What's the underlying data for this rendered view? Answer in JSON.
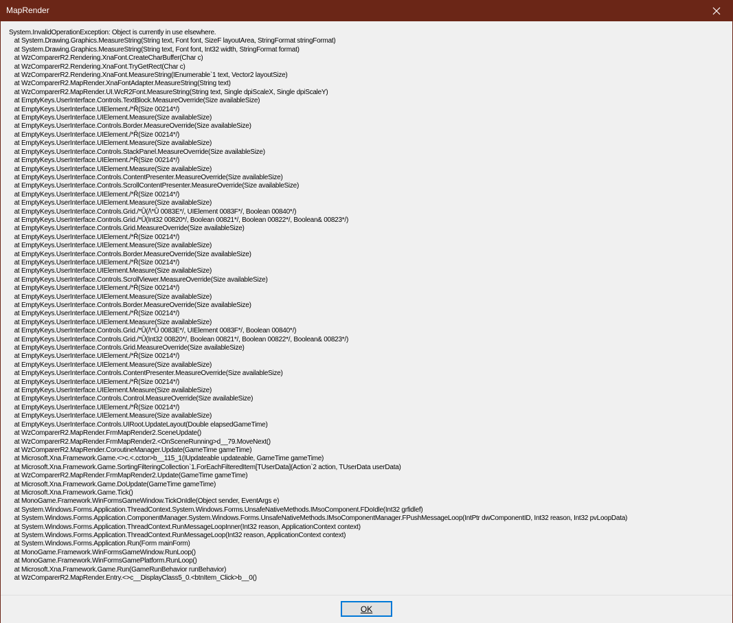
{
  "window": {
    "title": "MapRender",
    "close_icon": "close-icon"
  },
  "message": {
    "lines": [
      "System.InvalidOperationException: Object is currently in use elsewhere.",
      "   at System.Drawing.Graphics.MeasureString(String text, Font font, SizeF layoutArea, StringFormat stringFormat)",
      "   at System.Drawing.Graphics.MeasureString(String text, Font font, Int32 width, StringFormat format)",
      "   at WzComparerR2.Rendering.XnaFont.CreateCharBuffer(Char c)",
      "   at WzComparerR2.Rendering.XnaFont.TryGetRect(Char c)",
      "   at WzComparerR2.Rendering.XnaFont.MeasureString(IEnumerable`1 text, Vector2 layoutSize)",
      "   at WzComparerR2.MapRender.XnaFontAdapter.MeasureString(String text)",
      "   at WzComparerR2.MapRender.UI.WcR2Font.MeasureString(String text, Single dpiScaleX, Single dpiScaleY)",
      "   at EmptyKeys.UserInterface.Controls.TextBlock.MeasureOverride(Size availableSize)",
      "   at EmptyKeys.UserInterface.UIElement./*Ȓ(Size 00214*/)",
      "   at EmptyKeys.UserInterface.UIElement.Measure(Size availableSize)",
      "   at EmptyKeys.UserInterface.Controls.Border.MeasureOverride(Size availableSize)",
      "   at EmptyKeys.UserInterface.UIElement./*Ȓ(Size 00214*/)",
      "   at EmptyKeys.UserInterface.UIElement.Measure(Size availableSize)",
      "   at EmptyKeys.UserInterface.Controls.StackPanel.MeasureOverride(Size availableSize)",
      "   at EmptyKeys.UserInterface.UIElement./*Ȓ(Size 00214*/)",
      "   at EmptyKeys.UserInterface.UIElement.Measure(Size availableSize)",
      "   at EmptyKeys.UserInterface.Controls.ContentPresenter.MeasureOverride(Size availableSize)",
      "   at EmptyKeys.UserInterface.Controls.ScrollContentPresenter.MeasureOverride(Size availableSize)",
      "   at EmptyKeys.UserInterface.UIElement./*Ȓ(Size 00214*/)",
      "   at EmptyKeys.UserInterface.UIElement.Measure(Size availableSize)",
      "   at EmptyKeys.UserInterface.Controls.Grid./*Ǜ(/\\*Ǜ 0083E*/, UIElement 0083F*/, Boolean 00840*/)",
      "   at EmptyKeys.UserInterface.Controls.Grid./*Ǜ(Int32 00820*/, Boolean 00821*/, Boolean 00822*/, Boolean& 00823*/)",
      "   at EmptyKeys.UserInterface.Controls.Grid.MeasureOverride(Size availableSize)",
      "   at EmptyKeys.UserInterface.UIElement./*Ȓ(Size 00214*/)",
      "   at EmptyKeys.UserInterface.UIElement.Measure(Size availableSize)",
      "   at EmptyKeys.UserInterface.Controls.Border.MeasureOverride(Size availableSize)",
      "   at EmptyKeys.UserInterface.UIElement./*Ȓ(Size 00214*/)",
      "   at EmptyKeys.UserInterface.UIElement.Measure(Size availableSize)",
      "   at EmptyKeys.UserInterface.Controls.ScrollViewer.MeasureOverride(Size availableSize)",
      "   at EmptyKeys.UserInterface.UIElement./*Ȓ(Size 00214*/)",
      "   at EmptyKeys.UserInterface.UIElement.Measure(Size availableSize)",
      "   at EmptyKeys.UserInterface.Controls.Border.MeasureOverride(Size availableSize)",
      "   at EmptyKeys.UserInterface.UIElement./*Ȓ(Size 00214*/)",
      "   at EmptyKeys.UserInterface.UIElement.Measure(Size availableSize)",
      "   at EmptyKeys.UserInterface.Controls.Grid./*Ǜ(/\\*Ǜ 0083E*/, UIElement 0083F*/, Boolean 00840*/)",
      "   at EmptyKeys.UserInterface.Controls.Grid./*Ǜ(Int32 00820*/, Boolean 00821*/, Boolean 00822*/, Boolean& 00823*/)",
      "   at EmptyKeys.UserInterface.Controls.Grid.MeasureOverride(Size availableSize)",
      "   at EmptyKeys.UserInterface.UIElement./*Ȓ(Size 00214*/)",
      "   at EmptyKeys.UserInterface.UIElement.Measure(Size availableSize)",
      "   at EmptyKeys.UserInterface.Controls.ContentPresenter.MeasureOverride(Size availableSize)",
      "   at EmptyKeys.UserInterface.UIElement./*Ȓ(Size 00214*/)",
      "   at EmptyKeys.UserInterface.UIElement.Measure(Size availableSize)",
      "   at EmptyKeys.UserInterface.Controls.Control.MeasureOverride(Size availableSize)",
      "   at EmptyKeys.UserInterface.UIElement./*Ȓ(Size 00214*/)",
      "   at EmptyKeys.UserInterface.UIElement.Measure(Size availableSize)",
      "   at EmptyKeys.UserInterface.Controls.UIRoot.UpdateLayout(Double elapsedGameTime)",
      "   at WzComparerR2.MapRender.FrmMapRender2.SceneUpdate()",
      "   at WzComparerR2.MapRender.FrmMapRender2.<OnSceneRunning>d__79.MoveNext()",
      "   at WzComparerR2.MapRender.CoroutineManager.Update(GameTime gameTime)",
      "   at Microsoft.Xna.Framework.Game.<>c.<.cctor>b__115_1(IUpdateable updateable, GameTime gameTime)",
      "   at Microsoft.Xna.Framework.Game.SortingFilteringCollection`1.ForEachFilteredItem[TUserData](Action`2 action, TUserData userData)",
      "   at WzComparerR2.MapRender.FrmMapRender2.Update(GameTime gameTime)",
      "   at Microsoft.Xna.Framework.Game.DoUpdate(GameTime gameTime)",
      "   at Microsoft.Xna.Framework.Game.Tick()",
      "   at MonoGame.Framework.WinFormsGameWindow.TickOnIdle(Object sender, EventArgs e)",
      "   at System.Windows.Forms.Application.ThreadContext.System.Windows.Forms.UnsafeNativeMethods.IMsoComponent.FDoIdle(Int32 grfidlef)",
      "   at System.Windows.Forms.Application.ComponentManager.System.Windows.Forms.UnsafeNativeMethods.IMsoComponentManager.FPushMessageLoop(IntPtr dwComponentID, Int32 reason, Int32 pvLoopData)",
      "   at System.Windows.Forms.Application.ThreadContext.RunMessageLoopInner(Int32 reason, ApplicationContext context)",
      "   at System.Windows.Forms.Application.ThreadContext.RunMessageLoop(Int32 reason, ApplicationContext context)",
      "   at System.Windows.Forms.Application.Run(Form mainForm)",
      "   at MonoGame.Framework.WinFormsGameWindow.RunLoop()",
      "   at MonoGame.Framework.WinFormsGamePlatform.RunLoop()",
      "   at Microsoft.Xna.Framework.Game.Run(GameRunBehavior runBehavior)",
      "   at WzComparerR2.MapRender.Entry.<>c__DisplayClass5_0.<btnItem_Click>b__0()"
    ]
  },
  "footer": {
    "ok_label": "OK"
  }
}
